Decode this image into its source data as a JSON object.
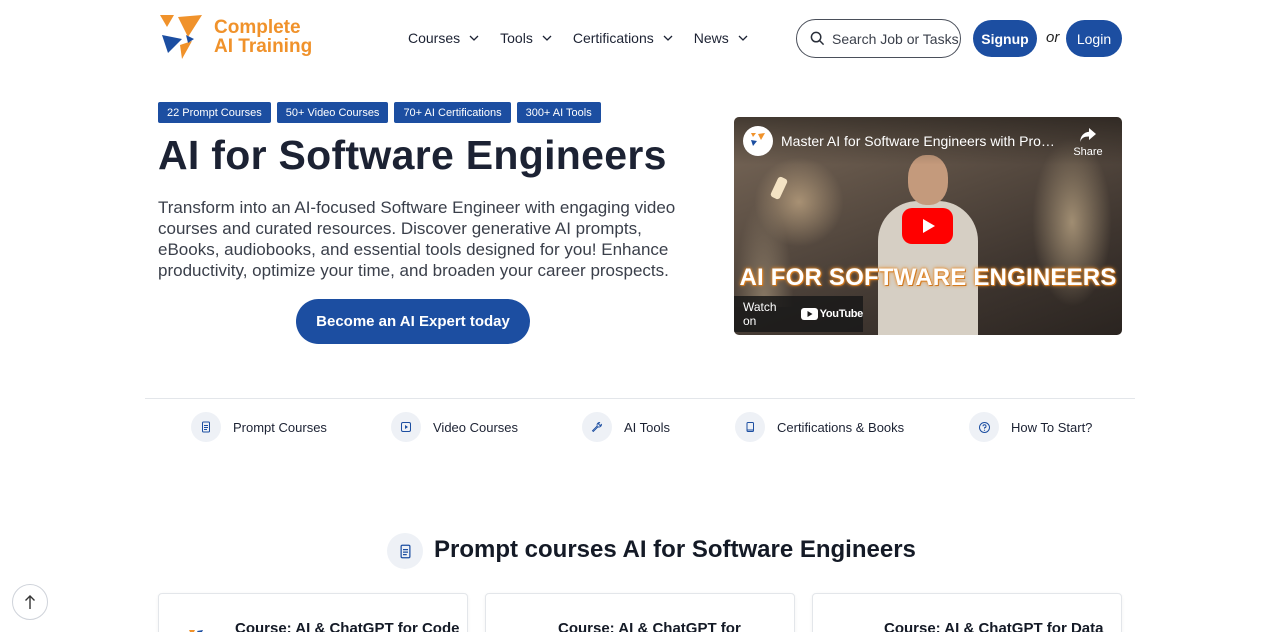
{
  "logo": {
    "line1": "Complete",
    "line2": "AI Training",
    "accent": "#f0922b",
    "mark_colors": [
      "#f0922b",
      "#1c4ea1"
    ]
  },
  "nav": {
    "items": [
      {
        "label": "Courses"
      },
      {
        "label": "Tools"
      },
      {
        "label": "Certifications"
      },
      {
        "label": "News"
      }
    ],
    "search_placeholder": "Search Job or Tasks",
    "signup": "Signup",
    "or": "or",
    "login": "Login"
  },
  "hero": {
    "badges": [
      "22 Prompt Courses",
      "50+ Video Courses",
      "70+ AI Certifications",
      "300+ AI Tools"
    ],
    "title": "AI for Software Engineers",
    "description": "Transform into an AI-focused Software Engineer with engaging video courses and curated resources. Discover generative AI prompts, eBooks, audiobooks, and essential tools designed for you! Enhance productivity, optimize your time, and broaden your career prospects.",
    "cta": "Become an AI Expert today"
  },
  "video": {
    "title": "Master AI for Software Engineers with Prompts…",
    "share": "Share",
    "overlay": "AI FOR SOFTWARE ENGINEERS",
    "watch_on": "Watch on",
    "youtube": "YouTube",
    "play_color": "#ff0000"
  },
  "quick_nav": [
    {
      "label": "Prompt Courses",
      "icon": "document-icon"
    },
    {
      "label": "Video Courses",
      "icon": "play-icon"
    },
    {
      "label": "AI Tools",
      "icon": "wrench-icon"
    },
    {
      "label": "Certifications & Books",
      "icon": "book-icon"
    },
    {
      "label": "How To Start?",
      "icon": "help-circle-icon"
    }
  ],
  "section": {
    "title": "Prompt courses AI for Software Engineers",
    "cards": [
      {
        "title": "Course: AI & ChatGPT for Code"
      },
      {
        "title": "Course: AI & ChatGPT for"
      },
      {
        "title": "Course: AI & ChatGPT for Data"
      }
    ]
  },
  "colors": {
    "primary": "#1c4ea1",
    "text": "#1c2233",
    "muted": "#3a3f4a"
  }
}
